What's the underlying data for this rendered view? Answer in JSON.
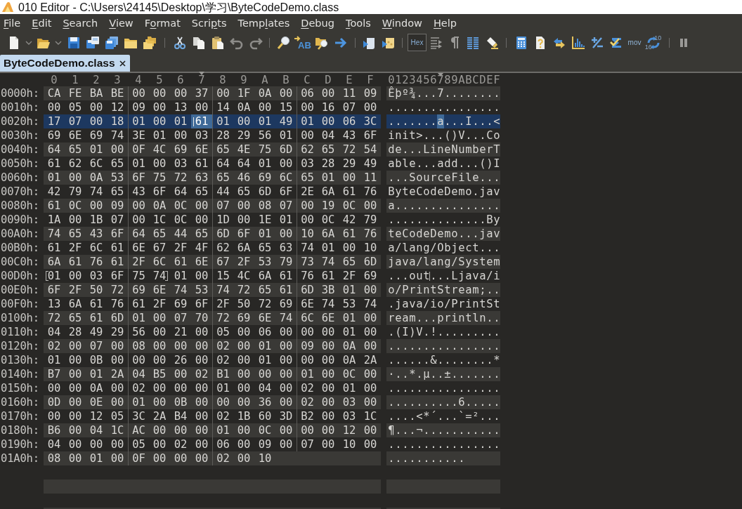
{
  "window": {
    "title": "010 Editor - C:\\Users\\24145\\Desktop\\学习\\ByteCodeDemo.class"
  },
  "menu": [
    {
      "label": "File",
      "underlined_letters": [
        true,
        false,
        false,
        false
      ]
    },
    {
      "label": "Edit",
      "underlined_letters": [
        true,
        false,
        false,
        false
      ]
    },
    {
      "label": "Search",
      "underlined_letters": [
        true,
        false,
        false,
        false,
        false,
        false
      ]
    },
    {
      "label": "View",
      "underlined_letters": [
        true,
        false,
        false,
        false
      ]
    },
    {
      "label": "Format",
      "underlined_letters": [
        false,
        true,
        false,
        false,
        false,
        false
      ]
    },
    {
      "label": "Scripts",
      "underlined_letters": [
        false,
        false,
        false,
        false,
        true,
        false,
        false
      ]
    },
    {
      "label": "Templates",
      "underlined_letters": [
        false,
        false,
        false,
        false,
        true,
        false,
        false,
        false,
        false
      ]
    },
    {
      "label": "Debug",
      "underlined_letters": [
        true,
        false,
        false,
        false,
        false
      ]
    },
    {
      "label": "Tools",
      "underlined_letters": [
        true,
        false,
        false,
        false,
        false
      ]
    },
    {
      "label": "Window",
      "underlined_letters": [
        true,
        false,
        false,
        false,
        false,
        false
      ]
    },
    {
      "label": "Help",
      "underlined_letters": [
        true,
        false,
        false,
        false
      ]
    }
  ],
  "toolbar": {
    "replace_label": "AB",
    "hex_toggle": {
      "label": "Hex",
      "selected": true
    },
    "asm_label": "mov",
    "radix_labels": [
      "10",
      "16"
    ]
  },
  "tabs": [
    {
      "label": "ByteCodeDemo.class",
      "selected": true
    }
  ],
  "hex_view": {
    "columns": [
      {
        "label": "0",
        "selected": false
      },
      {
        "label": "1",
        "selected": false
      },
      {
        "label": "2",
        "selected": false
      },
      {
        "label": "3",
        "selected": false
      },
      {
        "label": "4",
        "selected": false
      },
      {
        "label": "5",
        "selected": false
      },
      {
        "label": "6",
        "selected": false
      },
      {
        "label": "7",
        "selected": true
      },
      {
        "label": "8",
        "selected": false
      },
      {
        "label": "9",
        "selected": false
      },
      {
        "label": "A",
        "selected": false
      },
      {
        "label": "B",
        "selected": false
      },
      {
        "label": "C",
        "selected": false
      },
      {
        "label": "D",
        "selected": false
      },
      {
        "label": "E",
        "selected": false
      },
      {
        "label": "F",
        "selected": false
      }
    ],
    "ascii_header": "0123456789ABCDEF",
    "rows": [
      {
        "offset": "0000h:",
        "bytes": [
          "CA",
          "FE",
          "BA",
          "BE",
          "00",
          "00",
          "00",
          "37",
          "00",
          "1F",
          "0A",
          "00",
          "06",
          "00",
          "11",
          "09"
        ],
        "ascii": "Êþº¾...7........",
        "selected": false
      },
      {
        "offset": "0010h:",
        "bytes": [
          "00",
          "05",
          "00",
          "12",
          "09",
          "00",
          "13",
          "00",
          "14",
          "0A",
          "00",
          "15",
          "00",
          "16",
          "07",
          "00"
        ],
        "ascii": "................",
        "selected": false
      },
      {
        "offset": "0020h:",
        "bytes": [
          "17",
          "07",
          "00",
          "18",
          "01",
          "00",
          "01",
          "61",
          "01",
          "00",
          "01",
          "49",
          "01",
          "00",
          "06",
          "3C"
        ],
        "ascii": ".......a...I...<",
        "selected": true
      },
      {
        "offset": "0030h:",
        "bytes": [
          "69",
          "6E",
          "69",
          "74",
          "3E",
          "01",
          "00",
          "03",
          "28",
          "29",
          "56",
          "01",
          "00",
          "04",
          "43",
          "6F"
        ],
        "ascii": "init>...()V...Co",
        "selected": false
      },
      {
        "offset": "0040h:",
        "bytes": [
          "64",
          "65",
          "01",
          "00",
          "0F",
          "4C",
          "69",
          "6E",
          "65",
          "4E",
          "75",
          "6D",
          "62",
          "65",
          "72",
          "54"
        ],
        "ascii": "de...LineNumberT",
        "selected": false
      },
      {
        "offset": "0050h:",
        "bytes": [
          "61",
          "62",
          "6C",
          "65",
          "01",
          "00",
          "03",
          "61",
          "64",
          "64",
          "01",
          "00",
          "03",
          "28",
          "29",
          "49"
        ],
        "ascii": "able...add...()I",
        "selected": false
      },
      {
        "offset": "0060h:",
        "bytes": [
          "01",
          "00",
          "0A",
          "53",
          "6F",
          "75",
          "72",
          "63",
          "65",
          "46",
          "69",
          "6C",
          "65",
          "01",
          "00",
          "11"
        ],
        "ascii": "...SourceFile...",
        "selected": false
      },
      {
        "offset": "0070h:",
        "bytes": [
          "42",
          "79",
          "74",
          "65",
          "43",
          "6F",
          "64",
          "65",
          "44",
          "65",
          "6D",
          "6F",
          "2E",
          "6A",
          "61",
          "76"
        ],
        "ascii": "ByteCodeDemo.jav",
        "selected": false
      },
      {
        "offset": "0080h:",
        "bytes": [
          "61",
          "0C",
          "00",
          "09",
          "00",
          "0A",
          "0C",
          "00",
          "07",
          "00",
          "08",
          "07",
          "00",
          "19",
          "0C",
          "00"
        ],
        "ascii": "a...............",
        "selected": false
      },
      {
        "offset": "0090h:",
        "bytes": [
          "1A",
          "00",
          "1B",
          "07",
          "00",
          "1C",
          "0C",
          "00",
          "1D",
          "00",
          "1E",
          "01",
          "00",
          "0C",
          "42",
          "79"
        ],
        "ascii": "..............By",
        "selected": false
      },
      {
        "offset": "00A0h:",
        "bytes": [
          "74",
          "65",
          "43",
          "6F",
          "64",
          "65",
          "44",
          "65",
          "6D",
          "6F",
          "01",
          "00",
          "10",
          "6A",
          "61",
          "76"
        ],
        "ascii": "teCodeDemo...jav",
        "selected": false
      },
      {
        "offset": "00B0h:",
        "bytes": [
          "61",
          "2F",
          "6C",
          "61",
          "6E",
          "67",
          "2F",
          "4F",
          "62",
          "6A",
          "65",
          "63",
          "74",
          "01",
          "00",
          "10"
        ],
        "ascii": "a/lang/Object...",
        "selected": false
      },
      {
        "offset": "00C0h:",
        "bytes": [
          "6A",
          "61",
          "76",
          "61",
          "2F",
          "6C",
          "61",
          "6E",
          "67",
          "2F",
          "53",
          "79",
          "73",
          "74",
          "65",
          "6D"
        ],
        "ascii": "java/lang/System",
        "selected": false
      },
      {
        "offset": "00D0h:",
        "bytes": [
          "01",
          "00",
          "03",
          "6F",
          "75",
          "74",
          "01",
          "00",
          "15",
          "4C",
          "6A",
          "61",
          "76",
          "61",
          "2F",
          "69"
        ],
        "ascii": "...out...Ljava/i",
        "selected": false,
        "bracket_open": [
          true,
          false,
          false,
          false,
          false,
          false,
          false,
          false,
          false,
          false,
          false,
          false,
          false,
          false,
          false,
          false
        ],
        "bracket_close": [
          false,
          false,
          false,
          false,
          false,
          true,
          false,
          false,
          false,
          false,
          false,
          false,
          false,
          false,
          false,
          false
        ]
      },
      {
        "offset": "00E0h:",
        "bytes": [
          "6F",
          "2F",
          "50",
          "72",
          "69",
          "6E",
          "74",
          "53",
          "74",
          "72",
          "65",
          "61",
          "6D",
          "3B",
          "01",
          "00"
        ],
        "ascii": "o/PrintStream;..",
        "selected": false
      },
      {
        "offset": "00F0h:",
        "bytes": [
          "13",
          "6A",
          "61",
          "76",
          "61",
          "2F",
          "69",
          "6F",
          "2F",
          "50",
          "72",
          "69",
          "6E",
          "74",
          "53",
          "74"
        ],
        "ascii": ".java/io/PrintSt",
        "selected": false
      },
      {
        "offset": "0100h:",
        "bytes": [
          "72",
          "65",
          "61",
          "6D",
          "01",
          "00",
          "07",
          "70",
          "72",
          "69",
          "6E",
          "74",
          "6C",
          "6E",
          "01",
          "00"
        ],
        "ascii": "ream...println..",
        "selected": false
      },
      {
        "offset": "0110h:",
        "bytes": [
          "04",
          "28",
          "49",
          "29",
          "56",
          "00",
          "21",
          "00",
          "05",
          "00",
          "06",
          "00",
          "00",
          "00",
          "01",
          "00"
        ],
        "ascii": ".(I)V.!.........",
        "selected": false
      },
      {
        "offset": "0120h:",
        "bytes": [
          "02",
          "00",
          "07",
          "00",
          "08",
          "00",
          "00",
          "00",
          "02",
          "00",
          "01",
          "00",
          "09",
          "00",
          "0A",
          "00"
        ],
        "ascii": "................",
        "selected": false
      },
      {
        "offset": "0130h:",
        "bytes": [
          "01",
          "00",
          "0B",
          "00",
          "00",
          "00",
          "26",
          "00",
          "02",
          "00",
          "01",
          "00",
          "00",
          "00",
          "0A",
          "2A"
        ],
        "ascii": "......&........*",
        "selected": false
      },
      {
        "offset": "0140h:",
        "bytes": [
          "B7",
          "00",
          "01",
          "2A",
          "04",
          "B5",
          "00",
          "02",
          "B1",
          "00",
          "00",
          "00",
          "01",
          "00",
          "0C",
          "00"
        ],
        "ascii": "·..*.µ..±.......",
        "selected": false
      },
      {
        "offset": "0150h:",
        "bytes": [
          "00",
          "00",
          "0A",
          "00",
          "02",
          "00",
          "00",
          "00",
          "01",
          "00",
          "04",
          "00",
          "02",
          "00",
          "01",
          "00"
        ],
        "ascii": "................",
        "selected": false
      },
      {
        "offset": "0160h:",
        "bytes": [
          "0D",
          "00",
          "0E",
          "00",
          "01",
          "00",
          "0B",
          "00",
          "00",
          "00",
          "36",
          "00",
          "02",
          "00",
          "03",
          "00"
        ],
        "ascii": "..........6.....",
        "selected": false
      },
      {
        "offset": "0170h:",
        "bytes": [
          "00",
          "00",
          "12",
          "05",
          "3C",
          "2A",
          "B4",
          "00",
          "02",
          "1B",
          "60",
          "3D",
          "B2",
          "00",
          "03",
          "1C"
        ],
        "ascii": "....<*´...`=²...",
        "selected": false
      },
      {
        "offset": "0180h:",
        "bytes": [
          "B6",
          "00",
          "04",
          "1C",
          "AC",
          "00",
          "00",
          "00",
          "01",
          "00",
          "0C",
          "00",
          "00",
          "00",
          "12",
          "00"
        ],
        "ascii": "¶...¬...........",
        "selected": false
      },
      {
        "offset": "0190h:",
        "bytes": [
          "04",
          "00",
          "00",
          "00",
          "05",
          "00",
          "02",
          "00",
          "06",
          "00",
          "09",
          "00",
          "07",
          "00",
          "10",
          "00"
        ],
        "ascii": "................",
        "selected": false
      },
      {
        "offset": "01A0h:",
        "bytes": [
          "08",
          "00",
          "01",
          "00",
          "0F",
          "00",
          "00",
          "00",
          "02",
          "00",
          "10"
        ],
        "ascii": "...........",
        "selected": false
      }
    ]
  }
}
